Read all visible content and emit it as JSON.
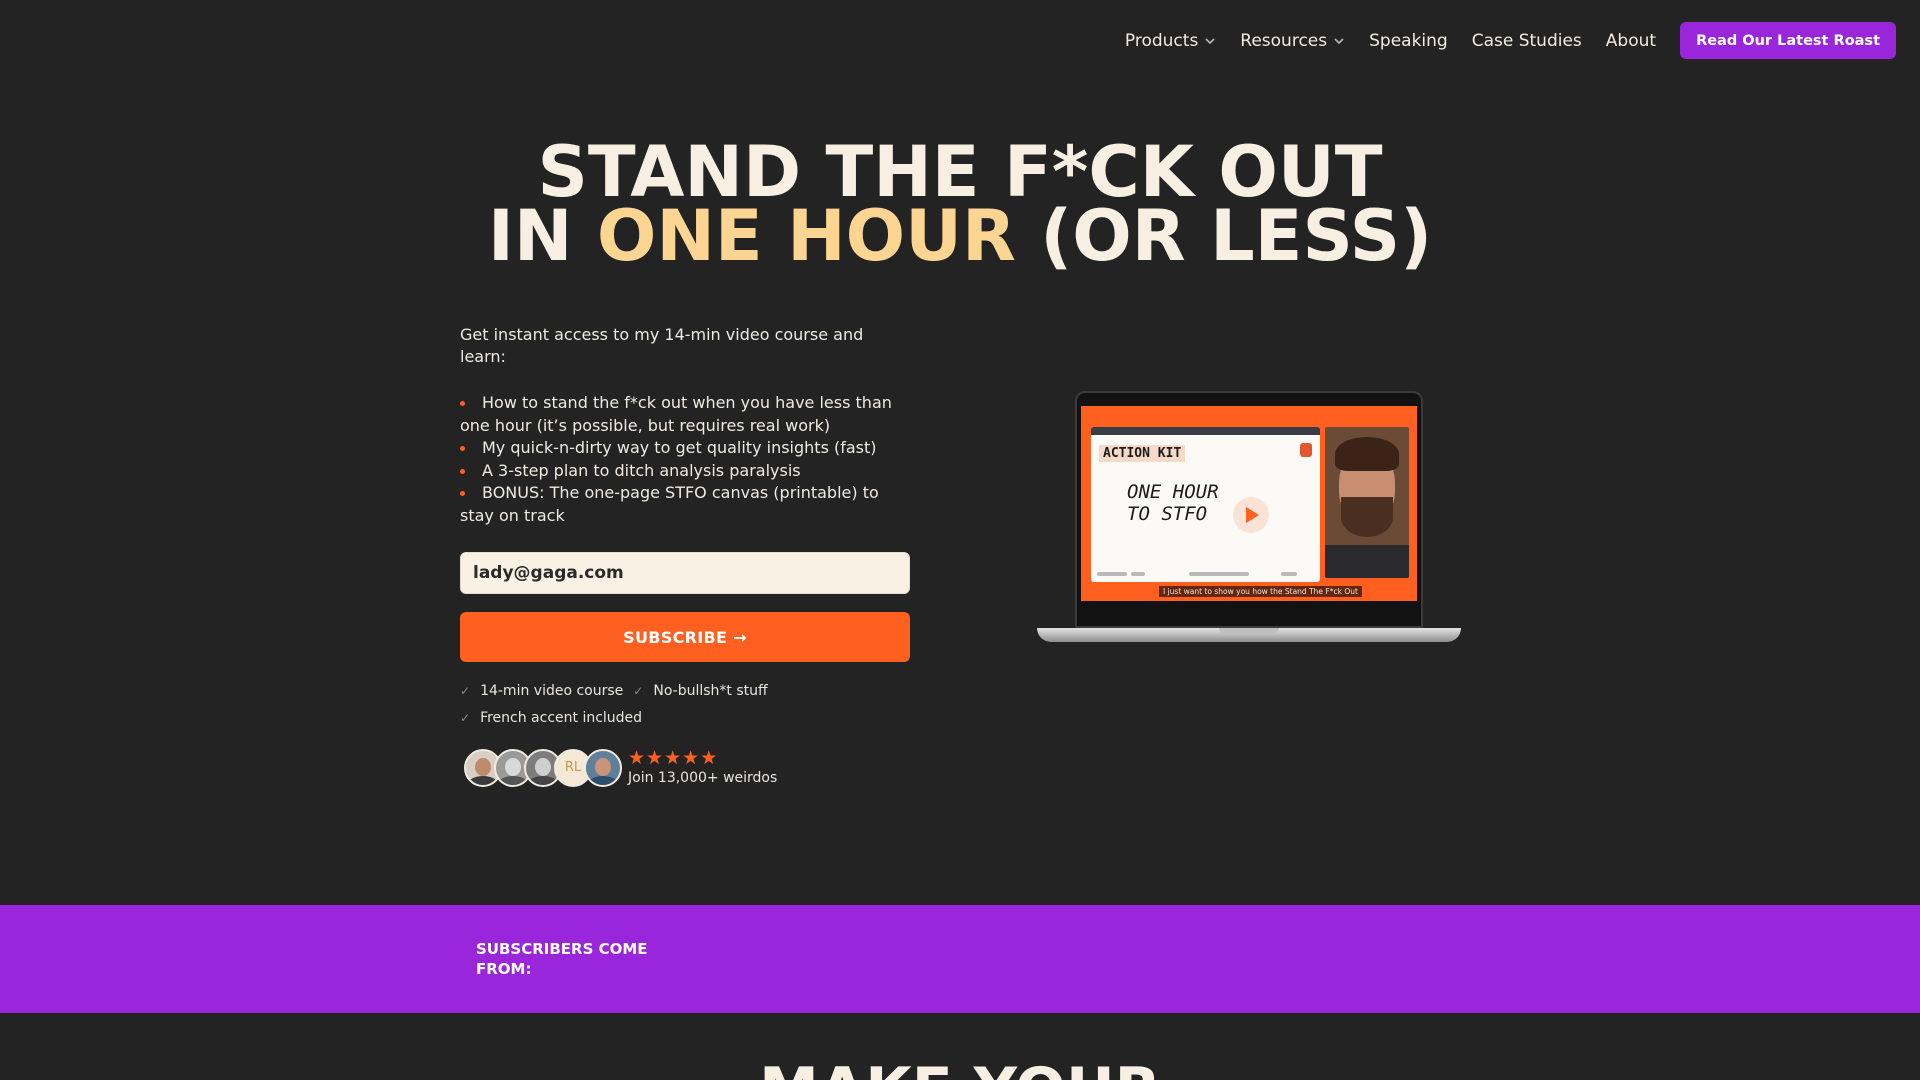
{
  "nav": {
    "items": [
      {
        "label": "Products",
        "dropdown": true
      },
      {
        "label": "Resources",
        "dropdown": true
      },
      {
        "label": "Speaking",
        "dropdown": false
      },
      {
        "label": "Case Studies",
        "dropdown": false
      },
      {
        "label": "About",
        "dropdown": false
      }
    ],
    "cta_label": "Read Our Latest Roast"
  },
  "hero": {
    "headline_line1": "STAND THE F*CK OUT",
    "headline_line2_pre": "IN ",
    "headline_line2_highlight": "ONE HOUR",
    "headline_line2_post": " (OR LESS)",
    "intro": "Get instant access to my 14-min video course and learn:",
    "bullets": [
      "How to stand the f*ck out when you have less than one hour (it’s possible, but requires real work)",
      "My quick-n-dirty way to get quality insights (fast)",
      "A 3-step plan to ditch analysis paralysis",
      "BONUS: The one-page STFO canvas (printable) to stay on track"
    ],
    "email_value": "lady@gaga.com",
    "subscribe_label": "SUBSCRIBE →",
    "checks": [
      "14-min video course",
      "No-bullsh*t stuff",
      "French accent included"
    ],
    "avatar_initials": "RL",
    "rating_stars": 5,
    "join_text": "Join 13,000+ weirdos"
  },
  "video": {
    "slide_tag": "ACTION KIT",
    "slide_title_line1": "ONE HOUR",
    "slide_title_line2": "TO STFO",
    "caption": "I just want to show you how the Stand The F*ck Out"
  },
  "band": {
    "label": "SUBSCRIBERS COME FROM:"
  },
  "next_section": {
    "headline": "MAKE YOUR"
  },
  "colors": {
    "background": "#232323",
    "accent_orange": "#ff5f1f",
    "accent_purple": "#9a26dc",
    "headline_highlight": "#fdd592",
    "cream": "#f6efe2"
  }
}
